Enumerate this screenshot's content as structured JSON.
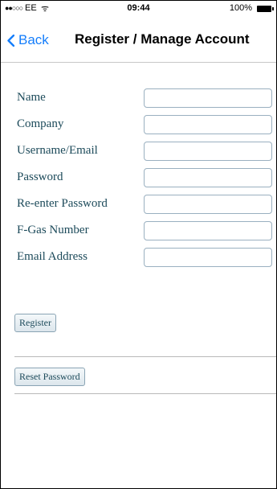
{
  "status_bar": {
    "signal": "●●○○○",
    "carrier": "EE",
    "wifi": "ᯤ",
    "time": "09:44",
    "battery": "100%"
  },
  "navbar": {
    "back_label": "Back",
    "title": "Register / Manage Account"
  },
  "form": {
    "fields": [
      {
        "label": "Name",
        "value": "",
        "placeholder": ""
      },
      {
        "label": "Company",
        "value": "",
        "placeholder": ""
      },
      {
        "label": "Username/Email",
        "value": "",
        "placeholder": ""
      },
      {
        "label": "Password",
        "value": "",
        "placeholder": ""
      },
      {
        "label": "Re-enter Password",
        "value": "",
        "placeholder": ""
      },
      {
        "label": "F-Gas Number",
        "value": "",
        "placeholder": ""
      },
      {
        "label": "Email Address",
        "value": "",
        "placeholder": ""
      }
    ]
  },
  "actions": {
    "register_label": "Register",
    "reset_label": "Reset Password"
  },
  "colors": {
    "accent": "#157efb",
    "label_text": "#1c4a5a"
  }
}
